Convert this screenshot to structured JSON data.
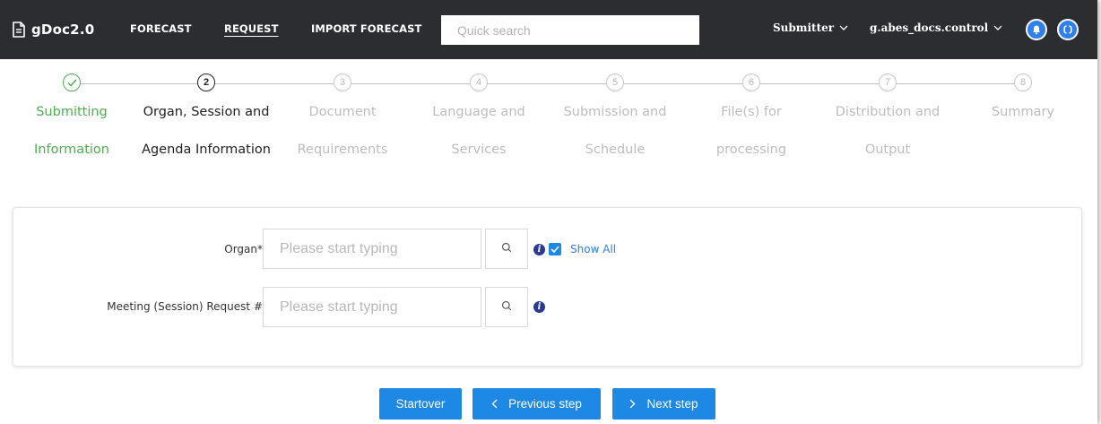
{
  "app": {
    "title": "gDoc2.0"
  },
  "nav": {
    "forecast": "FORECAST",
    "request": "REQUEST",
    "import_forecast": "IMPORT FORECAST",
    "active": "REQUEST"
  },
  "search": {
    "placeholder": "Quick search",
    "value": ""
  },
  "user_menu": {
    "role": "Submitter",
    "username": "g.abes_docs.control"
  },
  "header_icons": [
    "bell-icon",
    "sync-icon"
  ],
  "stepper": {
    "current_step": 2,
    "steps": [
      {
        "number": "✓",
        "line1": "Submitting",
        "line2": "Information",
        "state": "done"
      },
      {
        "number": "2",
        "line1": "Organ, Session and",
        "line2": "Agenda Information",
        "state": "current"
      },
      {
        "number": "3",
        "line1": "Document",
        "line2": "Requirements",
        "state": "pending"
      },
      {
        "number": "4",
        "line1": "Language and",
        "line2": "Services",
        "state": "pending"
      },
      {
        "number": "5",
        "line1": "Submission and",
        "line2": "Schedule",
        "state": "pending"
      },
      {
        "number": "6",
        "line1": "File(s) for",
        "line2": "processing",
        "state": "pending"
      },
      {
        "number": "7",
        "line1": "Distribution and",
        "line2": "Output",
        "state": "pending"
      },
      {
        "number": "8",
        "line1": "Summary",
        "line2": "",
        "state": "pending"
      }
    ]
  },
  "form": {
    "organ": {
      "label": "Organ*",
      "placeholder": "Please start typing",
      "value": "",
      "info": "i",
      "show_all_label": "Show All",
      "show_all_checked": true
    },
    "meeting": {
      "label": "Meeting (Session) Request #",
      "placeholder": "Please start typing",
      "value": "",
      "info": "i"
    }
  },
  "actions": {
    "startover": "Startover",
    "previous": "Previous step",
    "next": "Next step"
  },
  "colors": {
    "topbar": "#2b2d31",
    "accent": "#1e88e5",
    "done": "#4caf50",
    "pending": "#bdbdbd",
    "info": "#2a3c8f"
  }
}
